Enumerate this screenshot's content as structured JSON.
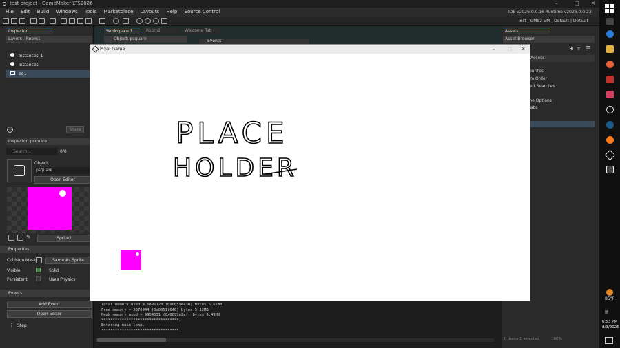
{
  "window": {
    "title": "test project - GameMaker-LTS2026",
    "minimize": "–",
    "maximize": "□",
    "close": "✕"
  },
  "menu": [
    "File",
    "Edit",
    "Build",
    "Windows",
    "Tools",
    "Marketplace",
    "Layouts",
    "Help",
    "Source Control"
  ],
  "ide_info": {
    "version": "IDE v2026.0.0.16  Runtime v2026.0.0.23",
    "target": "Test  |  GMS2 VM  |  Default  |  Default"
  },
  "left_panel": {
    "inspector_tab": "Inspector",
    "layers_title": "Layers - Room1",
    "layers": [
      {
        "name": "Instances_1"
      },
      {
        "name": "Instances"
      },
      {
        "name": "bg1"
      }
    ],
    "share_button": "Share",
    "inspector2_title": "Inspector: psquare",
    "search_placeholder": "Search...",
    "search_count": "0/0",
    "object_label": "Object",
    "object_name": "psquare",
    "open_editor": "Open Editor",
    "sprite_name": "Sprite2",
    "properties_header": "Properties",
    "collision_mask_label": "Collision Mask",
    "collision_mask_value": "Same As Sprite",
    "visible_label": "Visible",
    "solid_label": "Solid",
    "persistent_label": "Persistent",
    "uses_physics_label": "Uses Physics",
    "events_header": "Events",
    "add_event": "Add Event",
    "open_editor2": "Open Editor",
    "step_event": "Step"
  },
  "workspace": {
    "tabs": [
      "Workspace 1",
      "Room1",
      "Welcome Tab"
    ],
    "object_window_title": "Object: psquare",
    "events_window_title": "Events"
  },
  "right_panel": {
    "assets_tab": "Assets",
    "asset_browser": "Asset Browser",
    "items": [
      "Access",
      "Favourites",
      "Room Order",
      "Saved Searches",
      "Game Options",
      "Prefabs"
    ],
    "footer": "0 items  1 selected",
    "zoom": "100%"
  },
  "console": {
    "lines": [
      "Total memory used = 5891120 (0x0059e430) bytes 5.62MB",
      "Free memory = 5370944 (0x0051f640) bytes 5.12MB",
      "Peak memory used = 9954031 (0x0097e2ef) bytes 9.49MB",
      "**********************************.",
      "Entering main loop.",
      "**********************************."
    ]
  },
  "game_window": {
    "title": "Pixel Game",
    "placeholder_line1": "PLACE",
    "placeholder_line2": "HOLDER"
  },
  "taskbar": {
    "weather": "85°F",
    "time": "6:53 PM",
    "date": "8/3/2026"
  },
  "colors": {
    "magenta": "#ff00ff",
    "accent": "#5aa0ff"
  }
}
